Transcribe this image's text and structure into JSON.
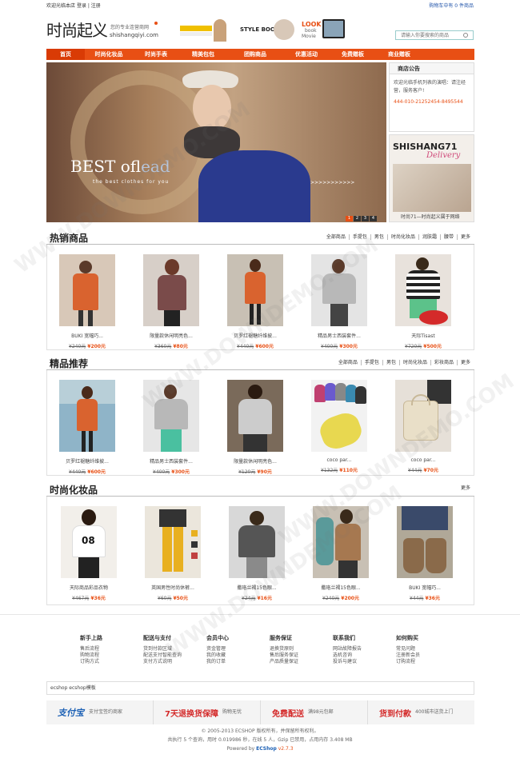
{
  "topbar": {
    "welcome": "欢迎光临本店",
    "login": "登录",
    "register": "注册",
    "cart": "购物车中有 0 件商品"
  },
  "logo": {
    "title": "时尚起义",
    "tagline": "您的专业连营商网",
    "domain": "shishangqiyi.com"
  },
  "header_ads": {
    "book": "STYLE BOOK",
    "look": "LOOK",
    "look_small": "book",
    "look_movie": "Movie"
  },
  "search": {
    "placeholder": "请输入你要搜索的商品"
  },
  "nav": [
    "首页",
    "时尚化妆品",
    "时尚手表",
    "精美包包",
    "团购商品",
    "优惠活动",
    "免费赠板",
    "商业赠板"
  ],
  "banner": {
    "headline": "BEST of",
    "headline_accent": "lead",
    "sub": "the best clothes for you",
    "arrows": ">>>>>>>>>>>",
    "dots": [
      "1",
      "2",
      "3",
      "4"
    ]
  },
  "notice": {
    "title": "商店公告",
    "text": "欢迎光临手机列表的演唱：请注经营，服务客户!",
    "phone": "444-010-21252454-8495544"
  },
  "side_ad": {
    "title": "SHISHANG71",
    "script": "Delivery",
    "caption": "时尚71—时尚起义属于网络"
  },
  "hot": {
    "title": "热销商品",
    "tabs": [
      "全部商品",
      "手提包",
      "男包",
      "时尚化妆品",
      "润肤霜",
      "腰带",
      "更多"
    ],
    "products": [
      {
        "name": "BUKI 宽幅巧...",
        "old": "¥240元",
        "new": "¥200元",
        "bg": "#d8c8b8",
        "fig": "#d9632f"
      },
      {
        "name": "限量款休闲明亮色...",
        "old": "¥360元",
        "new": "¥80元",
        "bg": "#d7cfc8",
        "fig": "#7a4b4a"
      },
      {
        "name": "贝罗红褪糖纤维披...",
        "old": "¥440元",
        "new": "¥600元",
        "bg": "#c8c0b4",
        "fig": "#d9632f"
      },
      {
        "name": "精品男士西装套件...",
        "old": "¥400元",
        "new": "¥300元",
        "bg": "#e4e4e4",
        "fig": "#b8b8b8"
      },
      {
        "name": "天际Tisast",
        "old": "¥720元",
        "new": "¥500元",
        "bg": "#e8e2dc",
        "fig": "#222222"
      }
    ]
  },
  "best": {
    "title": "精品推荐",
    "tabs": [
      "全部商品",
      "手提包",
      "男包",
      "时尚化妆品",
      "彩妆商品",
      "更多"
    ],
    "products": [
      {
        "name": "贝罗红褪糖纤维披...",
        "old": "¥440元",
        "new": "¥600元",
        "bg": "#8fb4c8",
        "fig": "#d9632f"
      },
      {
        "name": "精品男士西装套件...",
        "old": "¥400元",
        "new": "¥300元",
        "bg": "#e6e6e6",
        "fig": "#b8b8b8"
      },
      {
        "name": "限量款休闲明亮色...",
        "old": "¥120元",
        "new": "¥90元",
        "bg": "#7a6a5a",
        "fig": "#cccccc"
      },
      {
        "name": "coco par...",
        "old": "¥132元",
        "new": "¥110元",
        "bg": "#f2f2f2",
        "fig": "#e8d850"
      },
      {
        "name": "coco par...",
        "old": "¥44元",
        "new": "¥70元",
        "bg": "#e6e0d8",
        "fig": "#e9dfc8"
      }
    ]
  },
  "cosmetics": {
    "title": "时尚化妆品",
    "more": "更多",
    "products": [
      {
        "name": "天际商品彩品衣物",
        "old": "¥467元",
        "new": "¥36元",
        "bg": "#f2efea",
        "fig": "#ffffff"
      },
      {
        "name": "英国男性时尚休裤...",
        "old": "¥60元",
        "new": "¥50元",
        "bg": "#ebe6dc",
        "fig": "#e8b020"
      },
      {
        "name": "撒珞兰褐15色眼...",
        "old": "¥24元",
        "new": "¥16元",
        "bg": "#d8d8d8",
        "fig": "#555555"
      },
      {
        "name": "撒珞兰褐15色眼...",
        "old": "¥240元",
        "new": "¥200元",
        "bg": "#c8c0b4",
        "fig": "#a67850"
      },
      {
        "name": "BUKI 宽幅巧...",
        "old": "¥44元",
        "new": "¥36元",
        "bg": "#b0a898",
        "fig": "#8a6a4a"
      }
    ]
  },
  "footer_links": [
    {
      "title": "新手上路",
      "items": [
        "售后流程",
        "购物流程",
        "订购方式"
      ]
    },
    {
      "title": "配送与支付",
      "items": [
        "货到付款区域",
        "配送支付智能查询",
        "支付方式说明"
      ]
    },
    {
      "title": "会员中心",
      "items": [
        "资金管理",
        "我的收藏",
        "我的订单"
      ]
    },
    {
      "title": "服务保证",
      "items": [
        "退换货原则",
        "售后服务保证",
        "产品质量保证"
      ]
    },
    {
      "title": "联系我们",
      "items": [
        "网站故障报告",
        "选机咨询",
        "投诉与建议"
      ]
    },
    {
      "title": "如何购买",
      "items": [
        "常见问题",
        "注册新会员",
        "订购流程"
      ]
    }
  ],
  "friend_link": "ecshop ecshop模板",
  "guarantees": [
    {
      "brand": "支付宝",
      "text": "支付宝签约商家"
    },
    {
      "brand": "7天退换货保障",
      "text": "购物无忧"
    },
    {
      "brand": "免费配送",
      "text": "满98元包邮"
    },
    {
      "brand": "货到付款",
      "text": "400城市送货上门"
    }
  ],
  "copyright": {
    "line1": "© 2005-2013 ECSHOP 版权所有，并保留所有权利。",
    "line2": "共执行 5 个查询，用时 0.019986 秒，在线 5 人，Gzip 已禁用，占用内存 3.408 MB",
    "powered": "Powered by",
    "brand": "ECShop",
    "version": "v2.7.3"
  },
  "watermark": "WWW.DOWNDEMO.COM"
}
